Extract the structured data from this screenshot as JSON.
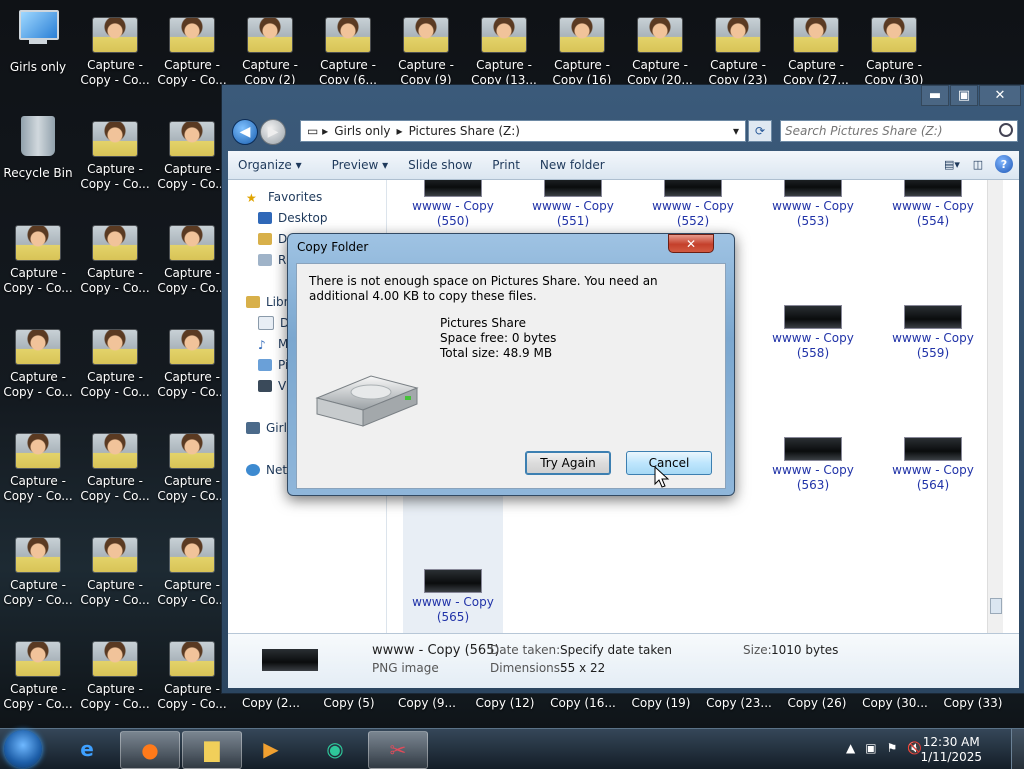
{
  "desktop": {
    "icons_col1": [
      {
        "label": "Girls only",
        "kind": "computer"
      },
      {
        "label": "Recycle Bin",
        "kind": "bin"
      },
      {
        "label": "Capture - Copy - Co...",
        "kind": "photo"
      },
      {
        "label": "Capture - Copy - Co...",
        "kind": "photo"
      },
      {
        "label": "Capture - Copy - Co...",
        "kind": "photo"
      },
      {
        "label": "Capture - Copy - Co...",
        "kind": "photo"
      },
      {
        "label": "Capture - Copy - Co...",
        "kind": "photo"
      }
    ],
    "icon_label_col2": "Capture - Copy - Co...",
    "icon_label_col3": "Capture - Copy - Co...",
    "top_row": [
      "Capture - Copy - Co...",
      "Capture - Copy - Co...",
      "Capture - Copy (2)",
      "Capture - Copy (6...",
      "Capture - Copy (9)",
      "Capture - Copy (13...",
      "Capture - Copy (16)",
      "Capture - Copy (20...",
      "Capture - Copy (23)",
      "Capture - Copy (27...",
      "Capture - Copy (30)"
    ],
    "bottom_row": [
      "Copy (2...",
      "Copy (5)",
      "Copy (9...",
      "Copy (12)",
      "Copy (16...",
      "Copy (19)",
      "Copy (23...",
      "Copy (26)",
      "Copy (30...",
      "Copy (33)"
    ]
  },
  "explorer": {
    "caption_buttons": [
      "▬",
      "▣",
      "✕"
    ],
    "breadcrumb": [
      "Girls only",
      "Pictures Share (Z:)"
    ],
    "search_placeholder": "Search Pictures Share (Z:)",
    "toolbar": [
      "Organize ▾",
      "Preview ▾",
      "Slide show",
      "Print",
      "New folder"
    ],
    "nav": {
      "favorites": "Favorites",
      "desktop": "Desktop",
      "d_item": "D",
      "r_item": "R",
      "libraries": "Libr",
      "lib_items": [
        "D",
        "M",
        "Pi",
        "Vi"
      ],
      "girls": "Girl",
      "network": "Net"
    },
    "files": [
      {
        "name": "wwww - Copy",
        "num": "(550)"
      },
      {
        "name": "wwww - Copy",
        "num": "(551)"
      },
      {
        "name": "wwww - Copy",
        "num": "(552)"
      },
      {
        "name": "wwww - Copy",
        "num": "(553)"
      },
      {
        "name": "wwww - Copy",
        "num": "(554)"
      },
      {
        "name": "wwww - Copy",
        "num": "(558)"
      },
      {
        "name": "wwww - Copy",
        "num": "(559)"
      },
      {
        "name": "wwww - Copy",
        "num": "(563)"
      },
      {
        "name": "wwww - Copy",
        "num": "(564)"
      },
      {
        "name": "wwww - Copy",
        "num": "(565)"
      }
    ],
    "details": {
      "filename": "wwww - Copy (565)",
      "filetype": "PNG image",
      "date_label": "Date taken:",
      "date_value": "Specify date taken",
      "dim_label": "Dimensions:",
      "dim_value": "55 x 22",
      "size_label": "Size:",
      "size_value": "1010 bytes"
    }
  },
  "dialog": {
    "title": "Copy Folder",
    "close": "✕",
    "message": "There is not enough space on Pictures Share. You need an additional 4.00 KB to copy these files.",
    "drive_name": "Pictures Share",
    "space_free": "Space free: 0 bytes",
    "total_size": "Total size: 48.9 MB",
    "try_again": "Try Again",
    "cancel": "Cancel"
  },
  "taskbar": {
    "clock_time": "12:30 AM",
    "clock_date": "1/11/2025"
  }
}
